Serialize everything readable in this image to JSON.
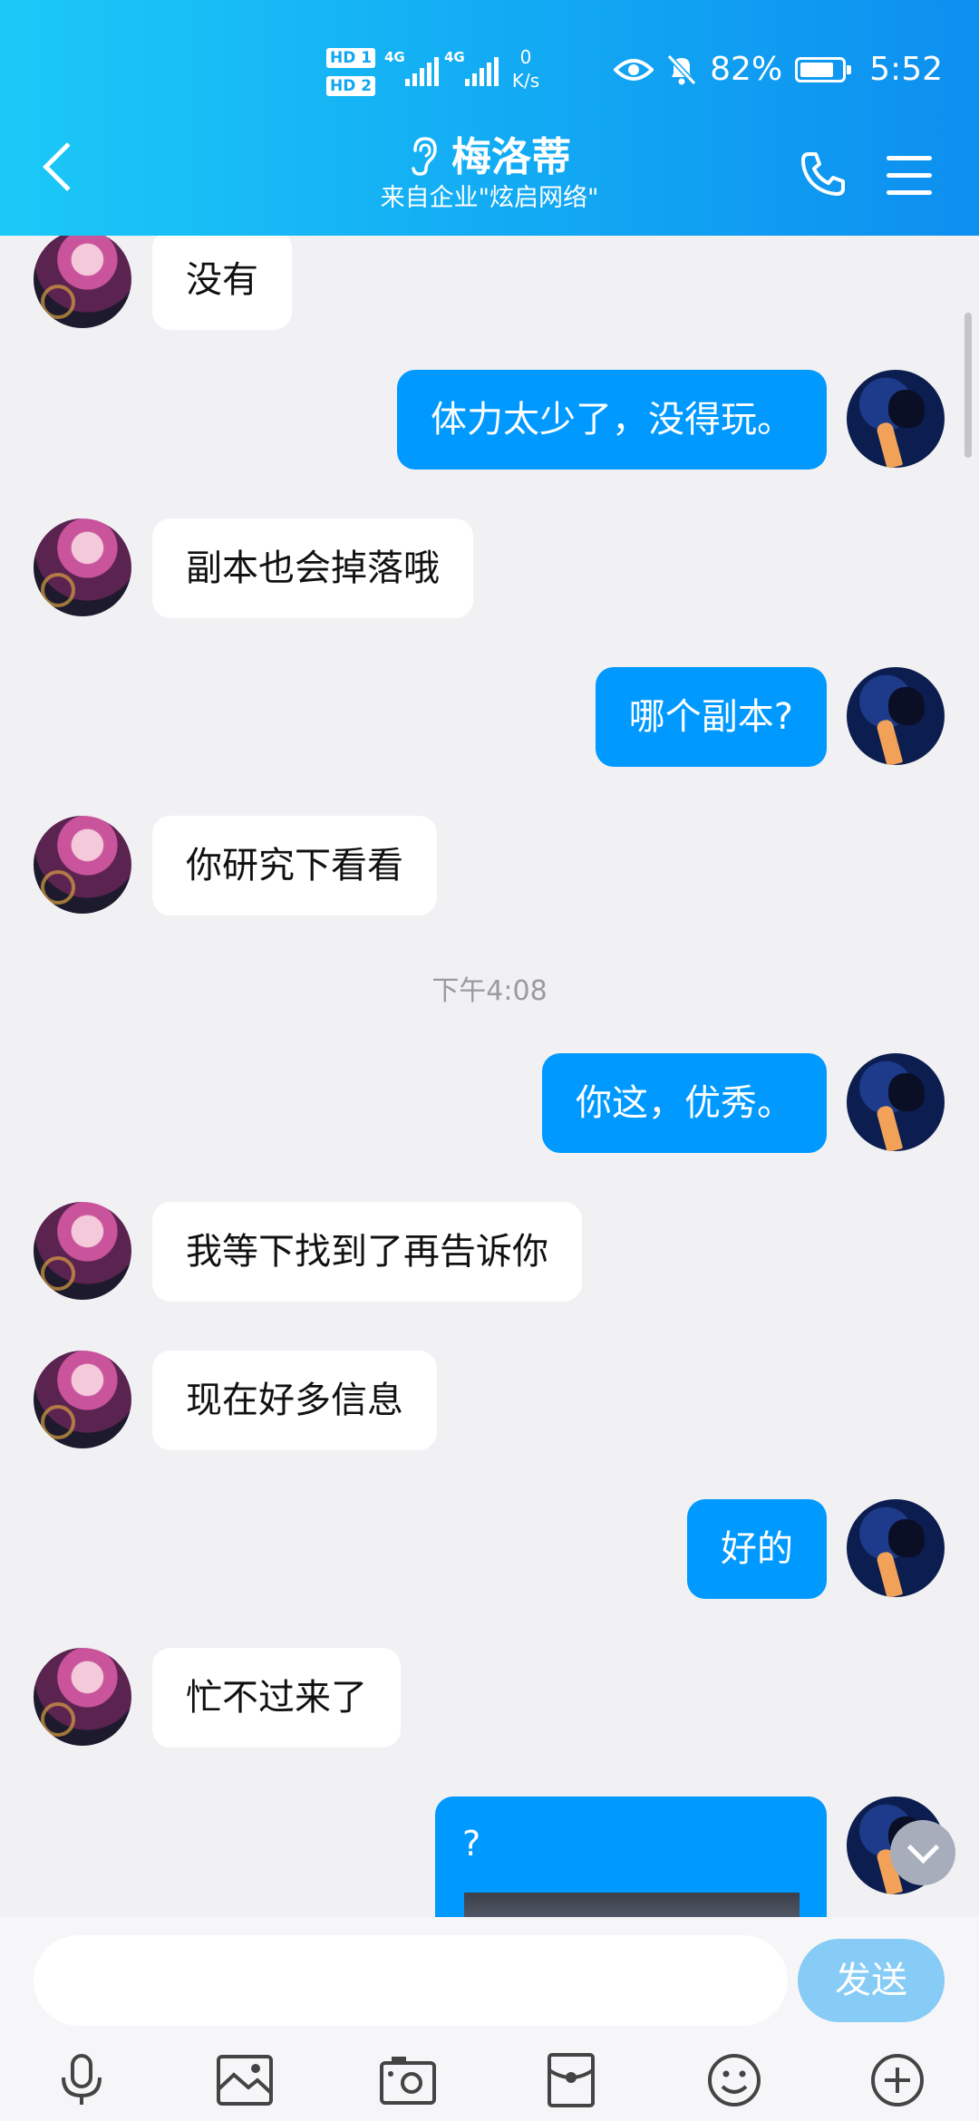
{
  "status_bar": {
    "hd1": "HD 1",
    "hd2": "HD 2",
    "net_speed_value": "0",
    "net_speed_unit": "K/s",
    "signal1": "4G",
    "signal2": "4G",
    "battery": "82%",
    "battery_level": 0.82,
    "time": "5:52"
  },
  "header": {
    "title": "梅洛蒂",
    "subtitle": "来自企业\"炫启网络\""
  },
  "messages": [
    {
      "side": "left",
      "text": "没有"
    },
    {
      "side": "right",
      "text": "体力太少了，没得玩。"
    },
    {
      "side": "left",
      "text": "副本也会掉落哦"
    },
    {
      "side": "right",
      "text": "哪个副本?"
    },
    {
      "side": "left",
      "text": "你研究下看看"
    },
    {
      "side": "right",
      "text": "你这，优秀。"
    },
    {
      "side": "left",
      "text": "我等下找到了再告诉你"
    },
    {
      "side": "left",
      "text": "现在好多信息"
    },
    {
      "side": "right",
      "text": "好的"
    },
    {
      "side": "left",
      "text": "忙不过来了"
    },
    {
      "side": "right",
      "text": "?"
    }
  ],
  "timestamp": "下午4:08",
  "input": {
    "value": "",
    "send_label": "发送"
  },
  "colors": {
    "header_start": "#1bc9f7",
    "header_end": "#0d8ff0",
    "bubble_sent": "#0099ff",
    "bubble_received": "#ffffff",
    "send_button": "#86ccf7"
  },
  "toolbar_icons": [
    "microphone-icon",
    "picture-icon",
    "camera-icon",
    "red-packet-icon",
    "emoji-icon",
    "plus-icon"
  ]
}
